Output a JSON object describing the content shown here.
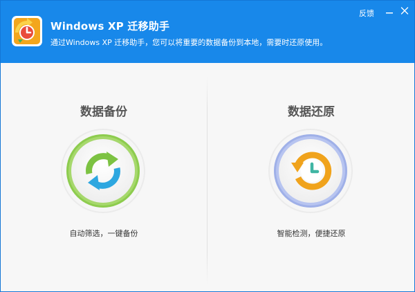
{
  "header": {
    "title": "Windows XP 迁移助手",
    "subtitle": "通过Windows XP 迁移助手，您可以将重要的数据备份到本地，需要时还原使用。",
    "feedback_label": "反馈",
    "background_color": "#1888ea",
    "logo_icon": "app-logo-icon",
    "minimize_icon": "minimize-icon",
    "close_icon": "close-icon"
  },
  "backup": {
    "title": "数据备份",
    "description": "自动筛选，一键备份",
    "icon": "refresh-arrows-icon",
    "ring_color": "#8dcc4e"
  },
  "restore": {
    "title": "数据还原",
    "description": "智能检测，便捷还原",
    "icon": "history-clock-icon",
    "ring_color": "#9fb0e8"
  }
}
